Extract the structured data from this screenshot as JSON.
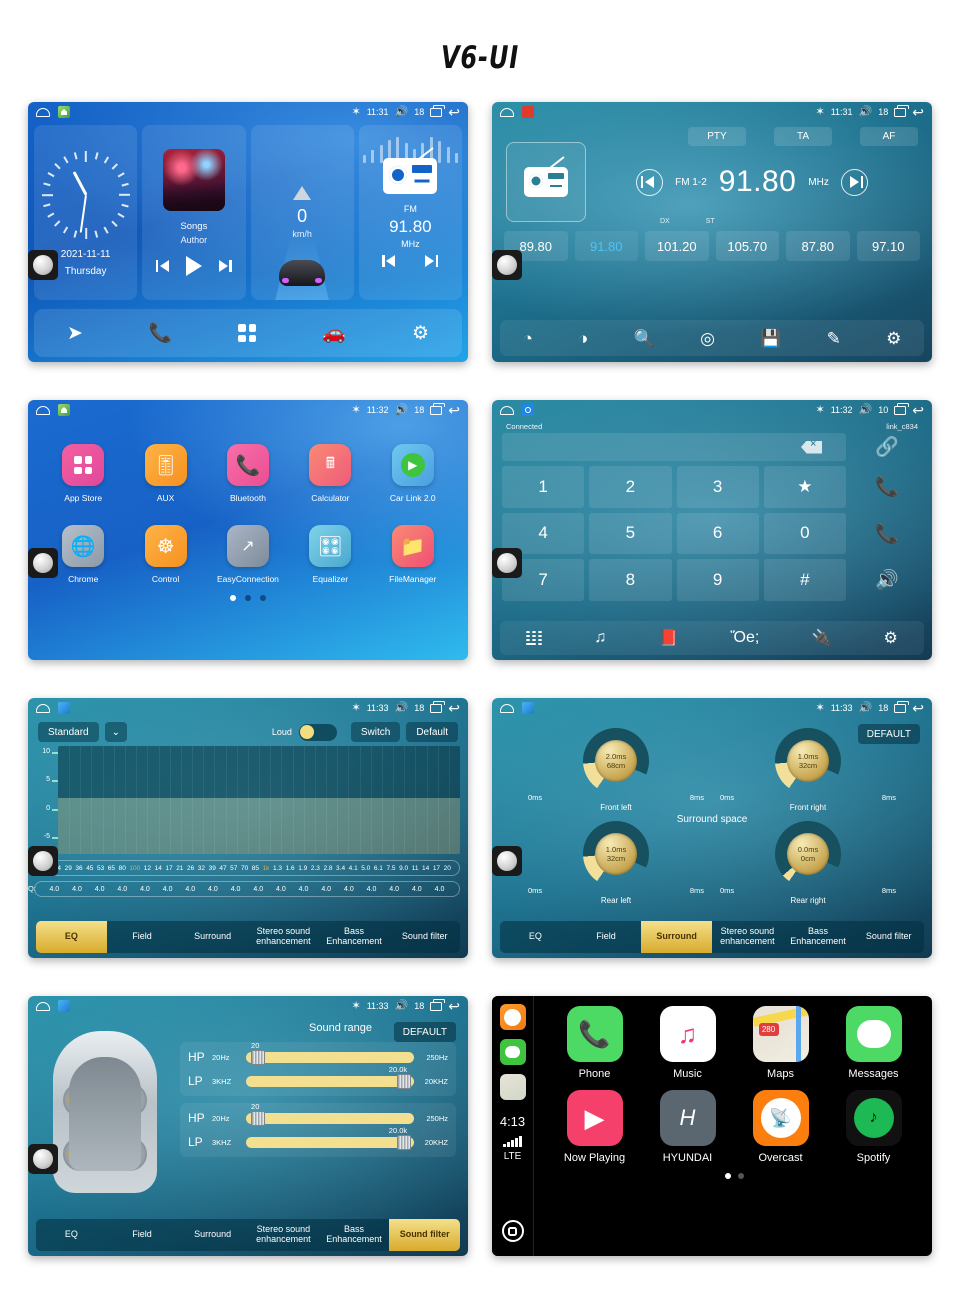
{
  "title": "V6-UI",
  "statusbar": {
    "time_1131": "11:31",
    "time_1132": "11:32",
    "time_1133": "11:33",
    "volume_18": "18",
    "volume_10": "10",
    "bluetooth_icon": "bluetooth-icon",
    "recents_icon": "recents-icon",
    "back_icon": "back-icon",
    "home_icon": "home-icon"
  },
  "home": {
    "clock": {
      "date": "2021-11-11",
      "day": "Thursday"
    },
    "music": {
      "song": "Songs",
      "artist": "Author"
    },
    "speed": {
      "value": "0",
      "unit": "km/h"
    },
    "radio": {
      "band": "FM",
      "freq": "91.80",
      "unit": "MHz"
    },
    "dock": [
      {
        "name": "navigation-icon",
        "glyph": "➤"
      },
      {
        "name": "phone-icon",
        "glyph": "☎"
      },
      {
        "name": "apps-icon",
        "glyph": ""
      },
      {
        "name": "carplay-icon",
        "glyph": "⇋"
      },
      {
        "name": "settings-icon",
        "glyph": "⚙"
      }
    ]
  },
  "radio": {
    "buttons": [
      "PTY",
      "TA",
      "AF"
    ],
    "band": "FM 1-2",
    "freq": "91.80",
    "unit": "MHz",
    "dx": "DX",
    "st": "ST",
    "presets": [
      {
        "value": "89.80",
        "active": false
      },
      {
        "value": "91.80",
        "active": true
      },
      {
        "value": "101.20",
        "active": false
      },
      {
        "value": "105.70",
        "active": false
      },
      {
        "value": "87.80",
        "active": false
      },
      {
        "value": "97.10",
        "active": false
      }
    ],
    "toolbar": [
      {
        "name": "band-icon",
        "glyph": "◔"
      },
      {
        "name": "stereo-icon",
        "glyph": "◑"
      },
      {
        "name": "search-icon",
        "glyph": "⌕"
      },
      {
        "name": "location-icon",
        "glyph": "◎"
      },
      {
        "name": "save-icon",
        "glyph": "Ὃe"
      },
      {
        "name": "edit-icon",
        "glyph": "✎"
      },
      {
        "name": "settings-icon",
        "glyph": "⚙"
      }
    ]
  },
  "apps": {
    "row1": [
      {
        "label": "App Store",
        "icon": "appstore-icon",
        "color1": "#f45fa0",
        "color2": "#e0489b"
      },
      {
        "label": "AUX",
        "icon": "aux-icon",
        "color1": "#ffb347",
        "color2": "#f59120"
      },
      {
        "label": "Bluetooth",
        "icon": "bluetooth-phone-icon",
        "color1": "#f76fa8",
        "color2": "#ec4d93"
      },
      {
        "label": "Calculator",
        "icon": "calculator-icon",
        "color1": "#f98a74",
        "color2": "#ef5b7b"
      },
      {
        "label": "Car Link 2.0",
        "icon": "carlink-icon",
        "color1": "#6fc9f0",
        "color2": "#4a9ee0"
      }
    ],
    "row2": [
      {
        "label": "Chrome",
        "icon": "chrome-icon",
        "color1": "#b6c0cb",
        "color2": "#8d99a8"
      },
      {
        "label": "Control",
        "icon": "steering-wheel-icon",
        "color1": "#ffb347",
        "color2": "#f59120"
      },
      {
        "label": "EasyConnection",
        "icon": "easyconnection-icon",
        "color1": "#aab6c4",
        "color2": "#7d8b9c"
      },
      {
        "label": "Equalizer",
        "icon": "equalizer-icon",
        "color1": "#7fd3e8",
        "color2": "#4aa7cf"
      },
      {
        "label": "FileManager",
        "icon": "filemanager-icon",
        "color1": "#f98a74",
        "color2": "#ef4f73"
      }
    ],
    "page_dots": 3,
    "active_dot": 0
  },
  "dialer": {
    "status_text": "Connected",
    "device_name": "link_c834",
    "input_value": "",
    "backspace_icon": "backspace-icon",
    "keys": [
      "1",
      "2",
      "3",
      "★",
      "4",
      "5",
      "6",
      "0",
      "7",
      "8",
      "9",
      "#"
    ],
    "side_actions": [
      {
        "name": "link-icon",
        "glyph": "ὑ7"
      },
      {
        "name": "call-accept-icon",
        "glyph": "☎"
      },
      {
        "name": "call-end-icon",
        "glyph": "☎"
      },
      {
        "name": "speaker-icon",
        "glyph": "ὐa"
      }
    ],
    "toolbar": [
      {
        "name": "keypad-icon"
      },
      {
        "name": "music-icon",
        "glyph": "♫"
      },
      {
        "name": "contacts-icon",
        "glyph": "Ὅ5"
      },
      {
        "name": "call-log-icon",
        "glyph": "☎"
      },
      {
        "name": "connect-icon",
        "glyph": "ὐc"
      },
      {
        "name": "settings-icon",
        "glyph": "⚙"
      }
    ]
  },
  "equalizer": {
    "preset": "Standard",
    "dropdown_icon": "chevron-down-icon",
    "loud_label": "Loud",
    "loud_on": false,
    "switch_label": "Switch",
    "default_label": "Default",
    "y_axis": [
      "10",
      "5",
      "0",
      "-5"
    ],
    "frequencies": [
      "20",
      "24",
      "29",
      "36",
      "45",
      "53",
      "65",
      "80",
      "100",
      "12",
      "14",
      "17",
      "21",
      "26",
      "32",
      "39",
      "47",
      "57",
      "70",
      "85",
      "1k",
      "1.3",
      "1.6",
      "1.9",
      "2.3",
      "2.8",
      "3.4",
      "4.1",
      "5.0",
      "6.1",
      "7.5",
      "9.0",
      "11",
      "14",
      "17",
      "20"
    ],
    "highlight_freqs": [
      "100",
      "1k"
    ],
    "q_label": "Q:",
    "q_values": [
      "4.0",
      "4.0",
      "4.0",
      "4.0",
      "4.0",
      "4.0",
      "4.0",
      "4.0",
      "4.0",
      "4.0",
      "4.0",
      "4.0",
      "4.0",
      "4.0",
      "4.0",
      "4.0",
      "4.0",
      "4.0"
    ],
    "tabs": [
      "EQ",
      "Field",
      "Surround",
      "Stereo sound enhancement",
      "Bass Enhancement",
      "Sound filter"
    ],
    "active_tab": "EQ"
  },
  "surround": {
    "default_label": "DEFAULT",
    "title": "Surround space",
    "knobs": [
      {
        "label": "Front left",
        "value_ms": "2.0ms",
        "value_cm": "68cm",
        "min": "0ms",
        "max": "8ms"
      },
      {
        "label": "Front right",
        "value_ms": "1.0ms",
        "value_cm": "32cm",
        "min": "0ms",
        "max": "8ms"
      },
      {
        "label": "Rear left",
        "value_ms": "1.0ms",
        "value_cm": "32cm",
        "min": "0ms",
        "max": "8ms"
      },
      {
        "label": "Rear right",
        "value_ms": "0.0ms",
        "value_cm": "0cm",
        "min": "0ms",
        "max": "8ms"
      }
    ],
    "active_tab": "Surround"
  },
  "soundfilter": {
    "title": "Sound range",
    "default_label": "DEFAULT",
    "groups": [
      {
        "rows": [
          {
            "tag": "HP",
            "min": "20Hz",
            "max": "250Hz",
            "value": "20",
            "pos": 3
          },
          {
            "tag": "LP",
            "min": "3KHZ",
            "max": "20KHZ",
            "value": "20.0k",
            "pos": 92
          }
        ]
      },
      {
        "rows": [
          {
            "tag": "HP",
            "min": "20Hz",
            "max": "250Hz",
            "value": "20",
            "pos": 3
          },
          {
            "tag": "LP",
            "min": "3KHZ",
            "max": "20KHZ",
            "value": "20.0k",
            "pos": 92
          }
        ]
      }
    ],
    "active_tab": "Sound filter"
  },
  "carplay": {
    "time": "4:13",
    "network": "LTE",
    "home_icon": "carplay-home-icon",
    "sidebar_icons": [
      "overcast-icon",
      "messages-icon",
      "maps-icon"
    ],
    "row1": [
      {
        "label": "Phone",
        "icon": "phone-icon"
      },
      {
        "label": "Music",
        "icon": "music-icon"
      },
      {
        "label": "Maps",
        "icon": "maps-icon"
      },
      {
        "label": "Messages",
        "icon": "messages-icon"
      }
    ],
    "row2": [
      {
        "label": "Now Playing",
        "icon": "now-playing-icon"
      },
      {
        "label": "HYUNDAI",
        "icon": "hyundai-icon"
      },
      {
        "label": "Overcast",
        "icon": "overcast-icon"
      },
      {
        "label": "Spotify",
        "icon": "spotify-icon"
      }
    ],
    "map_badge": "280",
    "page_dots": 2,
    "active_dot": 0
  }
}
